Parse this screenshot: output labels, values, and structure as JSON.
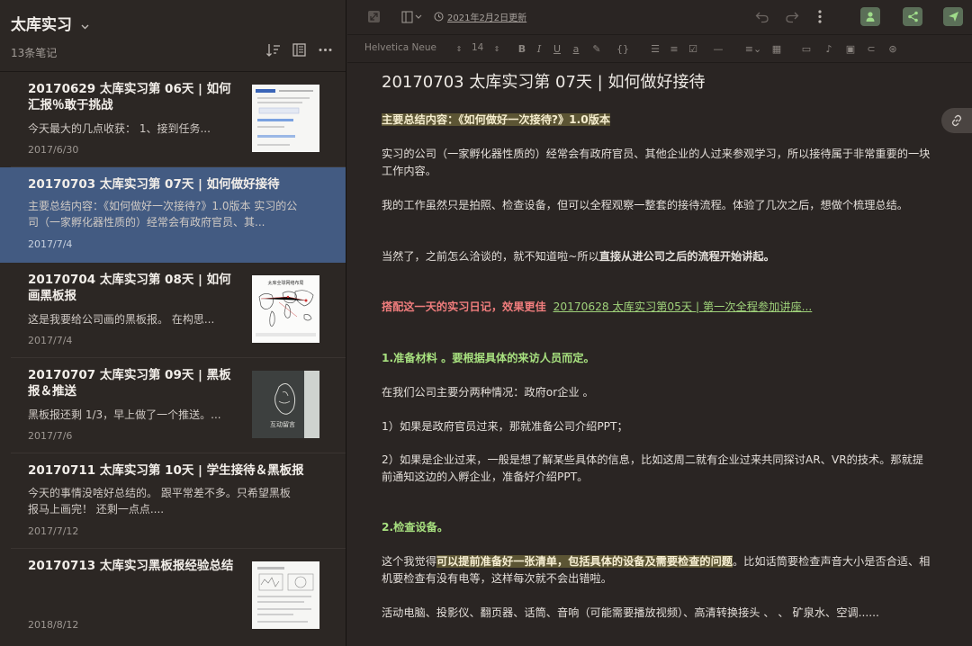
{
  "notebook": {
    "title": "太库实习",
    "count": "13条笔记"
  },
  "notes": [
    {
      "title": "20170629  太库实习第 06天 | 如何汇报％敢于挑战",
      "snippet": "今天最大的几点收获：  1、接到任务...",
      "date": "2017/6/30",
      "has_thumb": true,
      "selected": false
    },
    {
      "title": "20170703 太库实习第 07天 | 如何做好接待",
      "snippet": "主要总结内容：《如何做好一次接待?》1.0版本 实习的公司（一家孵化器性质的）经常会有政府官员、其...",
      "date": "2017/7/4",
      "has_thumb": false,
      "selected": true
    },
    {
      "title": "20170704  太库实习第 08天 | 如何画黑板报",
      "snippet": "这是我要给公司画的黑板报。 在构思...",
      "date": "2017/7/4",
      "has_thumb": true,
      "selected": false
    },
    {
      "title": "20170707 太库实习第 09天 | 黑板报＆推送",
      "snippet": "黑板报还剩 1/3，早上做了一个推送。...",
      "date": "2017/7/6",
      "has_thumb": true,
      "selected": false
    },
    {
      "title": "20170711  太库实习第 10天 | 学生接待＆黑板报",
      "snippet": "今天的事情没啥好总结的。 跟平常差不多。只希望黑板报马上画完！ 还剩一点点....",
      "date": "2017/7/12",
      "has_thumb": false,
      "selected": false
    },
    {
      "title": "20170713 太库实习黑板报经验总结",
      "snippet": "",
      "date": "2018/8/12",
      "has_thumb": true,
      "selected": false
    }
  ],
  "thumbs": {
    "map_title": "太库全球网络布局",
    "chalk_text": "互动留言"
  },
  "editor": {
    "updated": "2021年2月2日更新",
    "font": "Helvetica Neue",
    "size": "14",
    "title": "20170703 太库实习第 07天 | 如何做好接待",
    "p1": "主要总结内容：《如何做好一次接待?》1.0版本",
    "p2": "实习的公司（一家孵化器性质的）经常会有政府官员、其他企业的人过来参观学习，所以接待属于非常重要的一块工作内容。",
    "p3": "我的工作虽然只是拍照、检查设备，但可以全程观察一整套的接待流程。体验了几次之后，想做个梳理总结。",
    "p4a": "当然了，之前怎么洽谈的，就不知道啦~所以",
    "p4b": "直接从进公司之后的流程开始讲起。",
    "p5a": "搭配这一天的实习日记，效果更佳",
    "p5link": "20170628 太库实习第05天 | 第一次全程参加讲座...",
    "h1": "1.准备材料 。要根据具体的来访人员而定。",
    "p6": "在我们公司主要分两种情况：政府or企业 。",
    "p7": "1）如果是政府官员过来，那就准备公司介绍PPT；",
    "p8": "2）如果是企业过来，一般是想了解某些具体的信息，比如这周二就有企业过来共同探讨AR、VR的技术。那就提前通知这边的入孵企业，准备好介绍PPT。",
    "h2": "2.检查设备。",
    "p9a": "这个我觉得",
    "p9b": "可以提前准备好一张清单，包括具体的设备及需要检查的问题",
    "p9c": "。比如话筒要检查声音大小是否合适、相机要检查有没有电等，这样每次就不会出错啦。",
    "p10": "活动电脑、投影仪、翻页器、话筒、音响（可能需要播放视频）、高清转换接头 、    、 矿泉水、空调......"
  },
  "colors": {
    "selected_bg": "#435b82",
    "highlight_bg": "#5c5534",
    "red_text": "#f07d7d",
    "green_text": "#a7e07f",
    "action_green": "#5b6f58"
  }
}
